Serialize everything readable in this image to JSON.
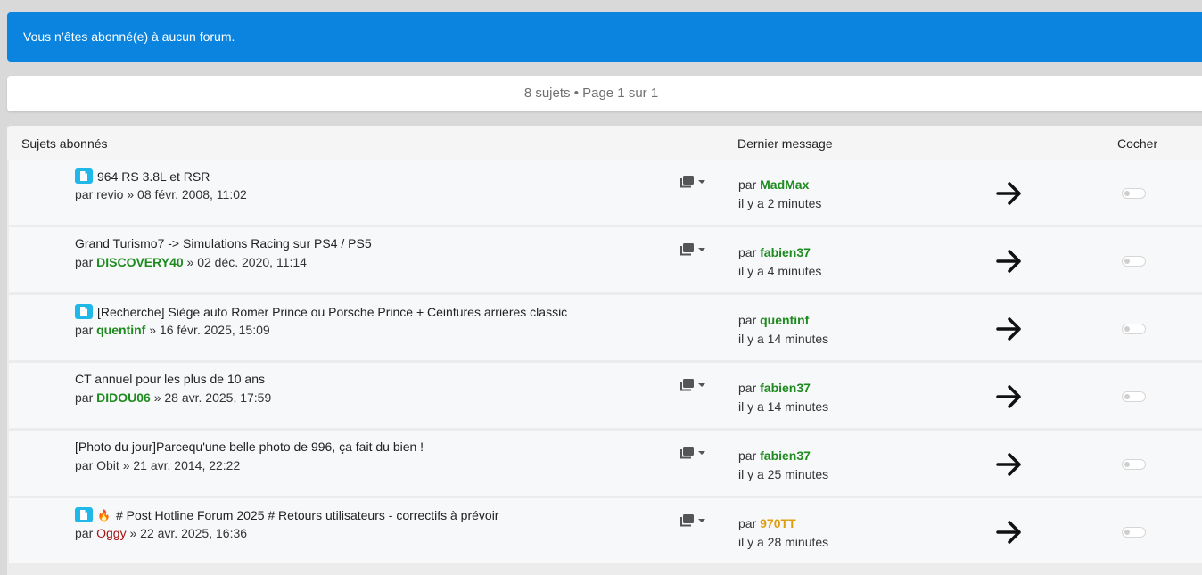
{
  "notice": {
    "text": "Vous n’êtes abonné(e) à aucun forum."
  },
  "pagination": {
    "text": "8 sujets • Page 1 sur 1"
  },
  "table": {
    "headers": {
      "topics": "Sujets abonnés",
      "last_post": "Dernier message",
      "mark": "Cocher"
    },
    "rows": [
      {
        "has_badge": true,
        "prefix": "",
        "title": "964 RS 3.8L et RSR",
        "by": "par",
        "author": "revio",
        "author_color": "plain",
        "date": "» 08 févr. 2008, 11:02",
        "has_pages": true,
        "last_by": "par",
        "last_author": "MadMax",
        "last_color": "green",
        "last_time": "il y a 2 minutes"
      },
      {
        "has_badge": false,
        "prefix": "",
        "title": "Grand Turismo7 -> Simulations Racing sur PS4 / PS5",
        "by": "par",
        "author": "DISCOVERY40",
        "author_color": "green",
        "date": "» 02 déc. 2020, 11:14",
        "has_pages": true,
        "last_by": "par",
        "last_author": "fabien37",
        "last_color": "green",
        "last_time": "il y a 4 minutes"
      },
      {
        "has_badge": true,
        "prefix": "",
        "title": "[Recherche] Siège auto Romer Prince ou Porsche Prince + Ceintures arrières classic",
        "by": "par",
        "author": "quentinf",
        "author_color": "green",
        "date": "» 16 févr. 2025, 15:09",
        "has_pages": false,
        "last_by": "par",
        "last_author": "quentinf",
        "last_color": "green",
        "last_time": "il y a 14 minutes"
      },
      {
        "has_badge": false,
        "prefix": "",
        "title": "CT annuel pour les plus de 10 ans",
        "by": "par",
        "author": "DIDOU06",
        "author_color": "green",
        "date": "» 28 avr. 2025, 17:59",
        "has_pages": true,
        "last_by": "par",
        "last_author": "fabien37",
        "last_color": "green",
        "last_time": "il y a 14 minutes"
      },
      {
        "has_badge": false,
        "prefix": "",
        "title": "[Photo du jour]Parcequ'une belle photo de 996, ça fait du bien !",
        "by": "par",
        "author": "Obit",
        "author_color": "plain",
        "date": "» 21 avr. 2014, 22:22",
        "has_pages": true,
        "last_by": "par",
        "last_author": "fabien37",
        "last_color": "green",
        "last_time": "il y a 25 minutes"
      },
      {
        "has_badge": true,
        "prefix": "🔥",
        "title": "# Post Hotline Forum 2025 # Retours utilisateurs - correctifs à prévoir",
        "by": "par",
        "author": "Oggy",
        "author_color": "red",
        "date": "» 22 avr. 2025, 16:36",
        "has_pages": true,
        "last_by": "par",
        "last_author": "970TT",
        "last_color": "orange",
        "last_time": "il y a 28 minutes"
      }
    ]
  },
  "icons": {
    "badge": "topic-file-icon",
    "pages": "pages-stack-icon",
    "goto": "arrow-right-icon",
    "mark": "toggle-switch"
  },
  "colors": {
    "notice_bg": "#0b84e0",
    "badge": "#1fb8e8",
    "green": "#1e8b1e",
    "red": "#a81212",
    "orange": "#e09d0f"
  }
}
